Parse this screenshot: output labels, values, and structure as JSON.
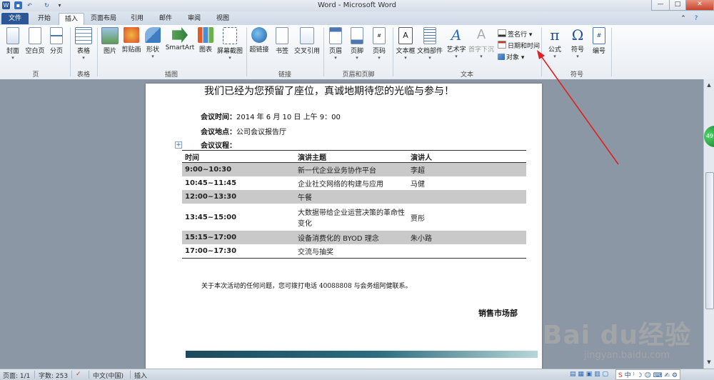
{
  "window": {
    "title": "Word - Microsoft Word",
    "minimize": "—",
    "maximize": "□",
    "close": "✕"
  },
  "tabs": [
    "文件",
    "开始",
    "插入",
    "页面布局",
    "引用",
    "邮件",
    "审阅",
    "视图"
  ],
  "ribbon": {
    "pages": {
      "cover": "封面",
      "blank": "空白页",
      "break": "分页",
      "group": "页"
    },
    "table": {
      "table": "表格",
      "group": "表格"
    },
    "illustrations": {
      "picture": "图片",
      "clipart": "剪贴画",
      "shapes": "形状",
      "smartart": "SmartArt",
      "chart": "图表",
      "screenshot": "屏幕截图",
      "group": "插图"
    },
    "links": {
      "hyperlink": "超链接",
      "bookmark": "书签",
      "crossref": "交叉引用",
      "group": "链接"
    },
    "header_footer": {
      "header": "页眉",
      "footer": "页脚",
      "page_number": "页码",
      "group": "页眉和页脚"
    },
    "text": {
      "textbox": "文本框",
      "quickparts": "文档部件",
      "wordart": "艺术字",
      "dropcap": "首字下沉",
      "signature": "签名行",
      "datetime": "日期和时间",
      "object": "对象",
      "group": "文本"
    },
    "symbols": {
      "equation": "公式",
      "symbol": "符号",
      "number": "编号",
      "group": "符号"
    }
  },
  "document": {
    "heading": "我们已经为您预留了座位，真诚地期待您的光临与参与！",
    "time_label": "会议时间：",
    "time_value": "2014 年 6 月 10 日 上午 9：00",
    "place_label": "会议地点：",
    "place_value": "公司会议报告厅",
    "agenda_label": "会议议程：",
    "table_headers": [
      "时间",
      "演讲主题",
      "演讲人"
    ],
    "rows": [
      {
        "time": "9:00~10:30",
        "topic": "新一代企业业务协作平台",
        "speaker": "李超",
        "shaded": true
      },
      {
        "time": "10:45~11:45",
        "topic": "企业社交网络的构建与应用",
        "speaker": "马健",
        "shaded": false
      },
      {
        "time": "12:00~13:30",
        "topic": "午餐",
        "speaker": "",
        "shaded": true
      },
      {
        "time": "13:45~15:00",
        "topic": "大数据带给企业运营决策的革命性变化",
        "speaker": "贾彤",
        "shaded": false
      },
      {
        "time": "15:15~17:00",
        "topic": "设备消费化的 BYOD 理念",
        "speaker": "朱小路",
        "shaded": true
      },
      {
        "time": "17:00~17:30",
        "topic": "交流与抽奖",
        "speaker": "",
        "shaded": false
      }
    ],
    "footnote": "关于本次活动的任何问题，您可拨打电话 40088808 与会务组阿健联系。",
    "signature": "销售市场部"
  },
  "status": {
    "page": "页面: 1/1",
    "words": "字数: 253",
    "language": "中文(中国)",
    "mode": "插入"
  },
  "badge": "49",
  "watermark": {
    "logo": "Bai du经验",
    "url": "jingyan.baidu.com"
  },
  "colors": {
    "file_tab": "#2b5797",
    "arrow": "#e02020",
    "table_shade": "#c9c9c9"
  }
}
